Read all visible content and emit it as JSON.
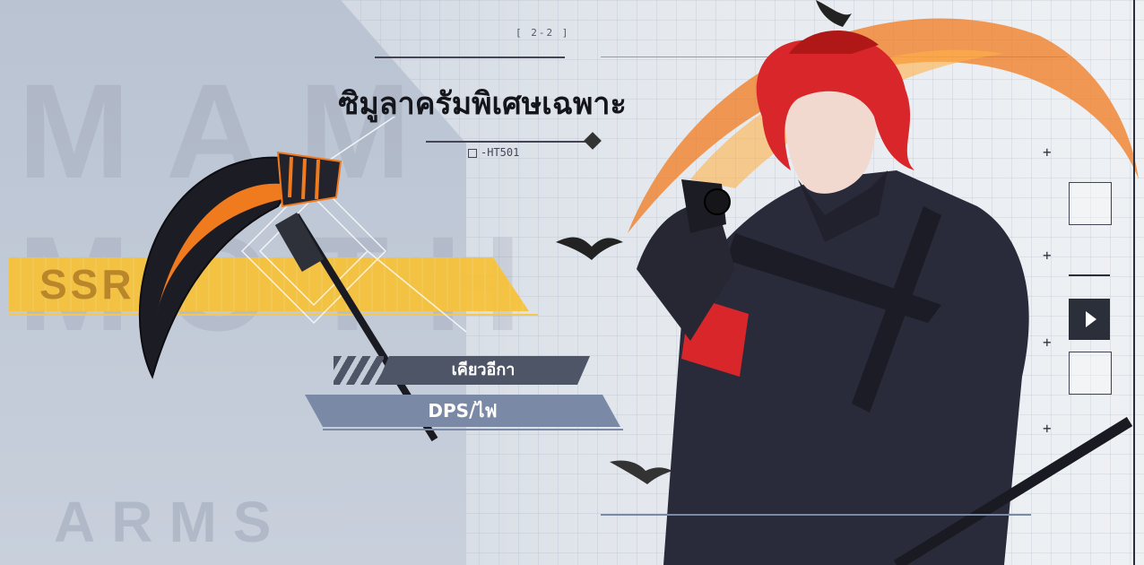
{
  "header": {
    "stage_tag": "[ 2-2 ]",
    "title": "ซิมูลาครัมพิเศษเฉพาะ",
    "code_tag": "-HT501"
  },
  "watermark": {
    "line1": "MAM",
    "line2": "MOTH",
    "line3": "ARMS"
  },
  "rarity": {
    "label": "SSR",
    "color": "#f7c23b"
  },
  "weapon": {
    "name": "เคียวอีกา",
    "role": "DPS/ไฟ"
  },
  "colors": {
    "accent_orange": "#f07a1e",
    "hair_red": "#d8262a",
    "coat_dark": "#2a2b3a",
    "tag_dark": "#4d5566",
    "tag_blue": "#7a8aa6"
  }
}
